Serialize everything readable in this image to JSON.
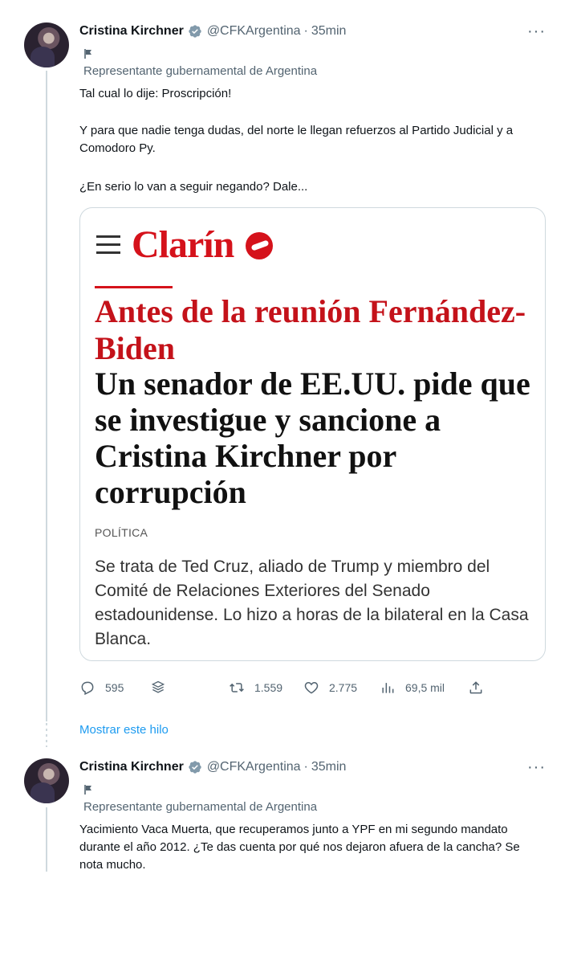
{
  "tweet1": {
    "author_name": "Cristina Kirchner",
    "handle": "@CFKArgentina",
    "separator": "·",
    "time": "35min",
    "more": "···",
    "gov_label": "Representante gubernamental de Argentina",
    "paragraphs": [
      "Tal cual lo dije: Proscripción!",
      "Y para que nadie tenga dudas, del norte le llegan refuerzos al Partido Judicial y a Comodoro Py.",
      "¿En serio lo van a seguir negando? Dale..."
    ],
    "card": {
      "logo": "Clarín",
      "headline_red": "Antes de la reunión Fernández-Biden",
      "headline": "Un senador de EE.UU. pide que se investigue y sancione a Cristina Kirchner por corrupción",
      "section": "POLÍTICA",
      "summary": "Se trata de Ted Cruz, aliado de Trump y miembro del Comité de Relaciones Exteriores del Senado estadounidense. Lo hizo a horas de la bilateral en la Casa Blanca."
    },
    "actions": {
      "replies": "595",
      "retweets": "1.559",
      "likes": "2.775",
      "views": "69,5 mil"
    },
    "show_thread": "Mostrar este hilo"
  },
  "tweet2": {
    "author_name": "Cristina Kirchner",
    "handle": "@CFKArgentina",
    "separator": "·",
    "time": "35min",
    "more": "···",
    "gov_label": "Representante gubernamental de Argentina",
    "text": "Yacimiento Vaca Muerta, que recuperamos junto a YPF en mi segundo mandato durante el año 2012. ¿Te das cuenta por qué nos dejaron afuera de la cancha? Se nota mucho."
  },
  "icons": {
    "verified": "verified-badge-icon",
    "flag": "government-flag-icon",
    "reply": "reply-icon",
    "stack": "stack-icon",
    "retweet": "retweet-icon",
    "like": "heart-icon",
    "views": "views-icon",
    "share": "share-icon"
  },
  "colors": {
    "link_blue": "#1d9bf0",
    "clarin_red": "#d5121b",
    "secondary_text": "#536471",
    "verified_gray": "#829aab"
  }
}
